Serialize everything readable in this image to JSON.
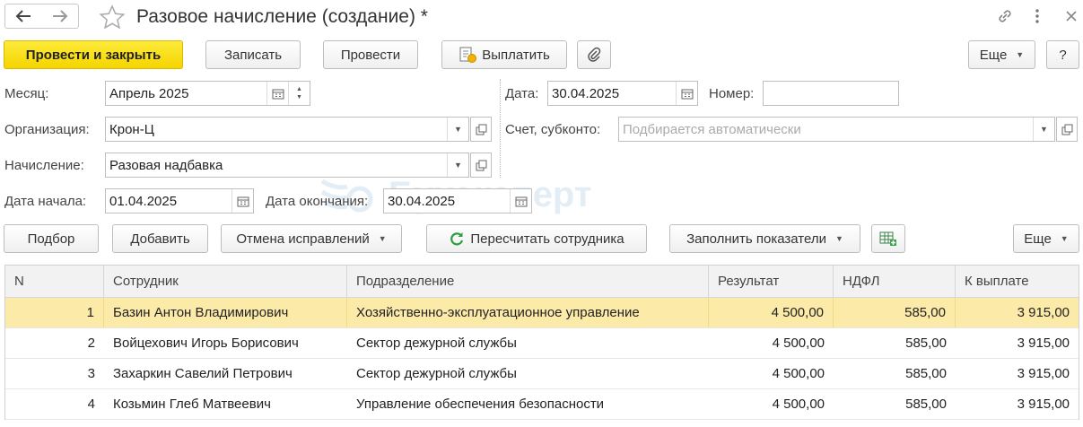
{
  "window": {
    "title": "Разовое начисление (создание) *"
  },
  "toolbar": {
    "post_close": "Провести и закрыть",
    "save": "Записать",
    "post": "Провести",
    "pay": "Выплатить",
    "more": "Еще",
    "help": "?"
  },
  "form": {
    "month_label": "Месяц:",
    "month_value": "Апрель 2025",
    "date_label": "Дата:",
    "date_value": "30.04.2025",
    "number_label": "Номер:",
    "number_value": "",
    "org_label": "Организация:",
    "org_value": "Крон-Ц",
    "account_label": "Счет, субконто:",
    "account_placeholder": "Подбирается автоматически",
    "accrual_label": "Начисление:",
    "accrual_value": "Разовая надбавка",
    "start_label": "Дата начала:",
    "start_value": "01.04.2025",
    "end_label": "Дата окончания:",
    "end_value": "30.04.2025"
  },
  "table_toolbar": {
    "select": "Подбор",
    "add": "Добавить",
    "cancel_fixes": "Отмена исправлений",
    "recalc": "Пересчитать сотрудника",
    "fill": "Заполнить показатели",
    "more": "Еще"
  },
  "table": {
    "headers": [
      "N",
      "Сотрудник",
      "Подразделение",
      "Результат",
      "НДФЛ",
      "К выплате"
    ],
    "rows": [
      {
        "n": "1",
        "employee": "Базин Антон Владимирович",
        "dept": "Хозяйственно-эксплуатационное управление",
        "result": "4 500,00",
        "ndfl": "585,00",
        "pay": "3 915,00"
      },
      {
        "n": "2",
        "employee": "Войцехович Игорь Борисович",
        "dept": "Сектор дежурной службы",
        "result": "4 500,00",
        "ndfl": "585,00",
        "pay": "3 915,00"
      },
      {
        "n": "3",
        "employee": "Захаркин Савелий Петрович",
        "dept": "Сектор дежурной службы",
        "result": "4 500,00",
        "ndfl": "585,00",
        "pay": "3 915,00"
      },
      {
        "n": "4",
        "employee": "Козьмин Глеб Матвеевич",
        "dept": "Управление обеспечения безопасности",
        "result": "4 500,00",
        "ndfl": "585,00",
        "pay": "3 915,00"
      }
    ]
  },
  "watermark": "Бухэксперт",
  "colors": {
    "primary": "#f5d500",
    "selected_row": "#fbeaa8",
    "recalc_icon": "#2e9e3e"
  }
}
